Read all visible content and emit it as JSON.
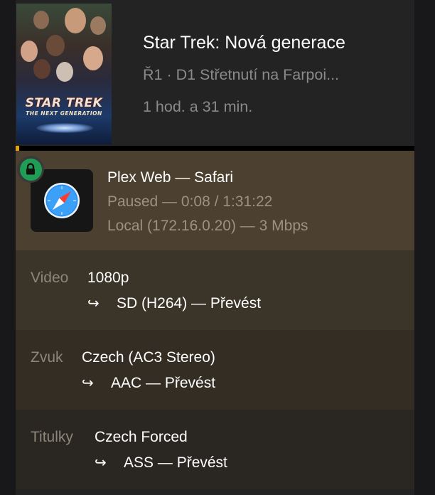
{
  "media": {
    "title": "Star Trek: Nová generace",
    "episode": "Ř1 · D1 Střetnutí na Farpoi...",
    "duration": "1 hod. a 31 min.",
    "poster": {
      "logo_text": "STAR TREK",
      "tagline": "THE NEXT GENERATION"
    }
  },
  "player": {
    "name": "Plex Web  —  Safari",
    "state": "Paused — 0:08 / 1:31:22",
    "network": "Local (172.16.0.20) — 3 Mbps",
    "icon": "safari-compass-icon",
    "secure_icon": "lock-icon"
  },
  "streams": {
    "video": {
      "label": "Video",
      "value": "1080p",
      "arrow": "↪",
      "detail": "SD (H264) — Převést"
    },
    "audio": {
      "label": "Zvuk",
      "value": "Czech (AC3 Stereo)",
      "arrow": "↪",
      "detail": "AAC — Převést"
    },
    "subtitles": {
      "label": "Titulky",
      "value": "Czech Forced",
      "arrow": "↪",
      "detail": "ASS — Převést"
    }
  },
  "colors": {
    "accent": "#e5a00d",
    "secure": "#1f9d55",
    "player_bg": "#4c4131"
  }
}
